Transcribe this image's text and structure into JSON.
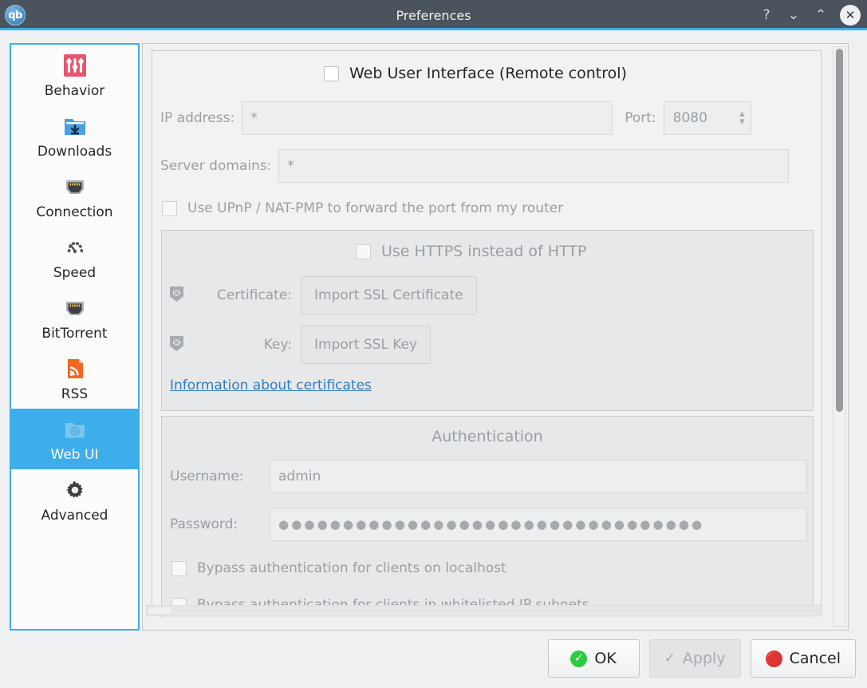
{
  "window": {
    "title": "Preferences",
    "logo_text": "qb",
    "buttons": {
      "help": "?",
      "minimize": "⌄",
      "maximize": "⌃",
      "close": "✕"
    }
  },
  "sidebar": {
    "items": [
      {
        "label": "Behavior",
        "icon": "sliders-icon",
        "selected": false
      },
      {
        "label": "Downloads",
        "icon": "download-folder-icon",
        "selected": false
      },
      {
        "label": "Connection",
        "icon": "network-port-icon",
        "selected": false
      },
      {
        "label": "Speed",
        "icon": "speedometer-icon",
        "selected": false
      },
      {
        "label": "BitTorrent",
        "icon": "network-port-icon",
        "selected": false
      },
      {
        "label": "RSS",
        "icon": "rss-feed-icon",
        "selected": false
      },
      {
        "label": "Web UI",
        "icon": "webui-folder-icon",
        "selected": true
      },
      {
        "label": "Advanced",
        "icon": "gear-icon",
        "selected": false
      }
    ]
  },
  "webui": {
    "enable_label": "Web User Interface (Remote control)",
    "enable_checked": false,
    "ip_address_label": "IP address:",
    "ip_address_value": "*",
    "port_label": "Port:",
    "port_value": "8080",
    "server_domains_label": "Server domains:",
    "server_domains_value": "*",
    "upnp_label": "Use UPnP / NAT-PMP to forward the port from my router",
    "upnp_checked": false,
    "https": {
      "use_https_label": "Use HTTPS instead of HTTP",
      "use_https_checked": false,
      "certificate_label": "Certificate:",
      "certificate_button": "Import SSL Certificate",
      "key_label": "Key:",
      "key_button": "Import SSL Key",
      "info_link": "Information about certificates"
    },
    "authentication": {
      "title": "Authentication",
      "username_label": "Username:",
      "username_value": "admin",
      "password_label": "Password:",
      "password_mask": "●●●●●●●●●●●●●●●●●●●●●●●●●●●●●●●●●",
      "bypass_localhost_label": "Bypass authentication for clients on localhost",
      "bypass_localhost_checked": false,
      "bypass_subnets_label": "Bypass authentication for clients in whitelisted IP subnets",
      "bypass_subnets_checked": false
    }
  },
  "footer": {
    "ok": "OK",
    "apply": "Apply",
    "cancel": "Cancel",
    "apply_enabled": false
  },
  "colors": {
    "titlebar": "#4b535c",
    "accent": "#3daee9",
    "window_bg": "#eff0f1",
    "link": "#2d7dc0",
    "ok_badge": "#2ecc40",
    "cancel_badge": "#dd3333"
  }
}
